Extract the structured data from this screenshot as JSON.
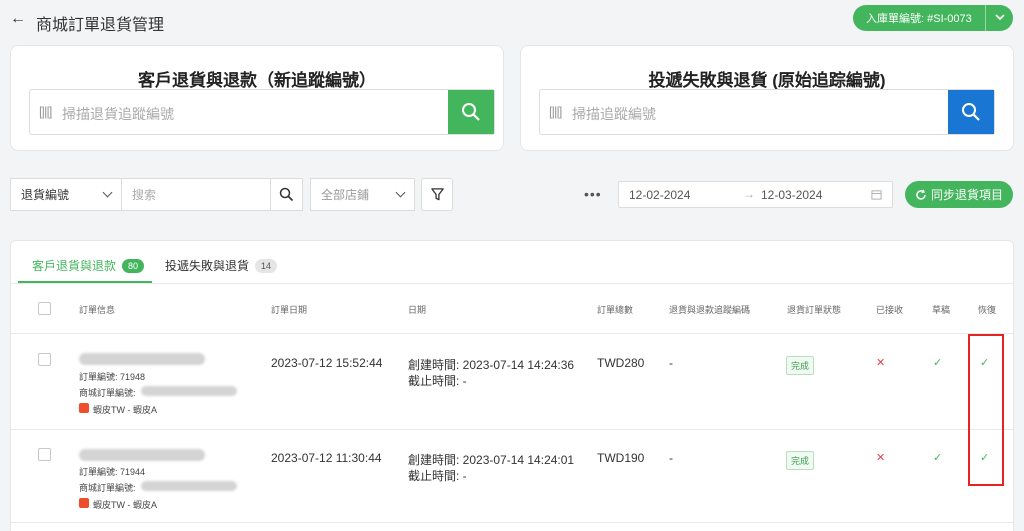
{
  "header": {
    "title": "商城訂單退貨管理",
    "inbound_label": "入庫單編號: #SI-0073"
  },
  "cards": [
    {
      "title": "客戶退貨與退款（新追蹤編號）",
      "placeholder": "掃描退貨追蹤編號"
    },
    {
      "title": "投遞失敗與退貨 (原始追踪編號)",
      "placeholder": "掃描追蹤編號"
    }
  ],
  "filters": {
    "field_select": "退貨編號",
    "search_placeholder": "搜索",
    "store_select": "全部店鋪",
    "more": "•••",
    "date_start": "12-02-2024",
    "date_arrow": "→",
    "date_end": "12-03-2024",
    "sync_label": "同步退貨項目"
  },
  "tabs": [
    {
      "label": "客戶退貨與退款",
      "count": "80"
    },
    {
      "label": "投遞失敗與退貨",
      "count": "14"
    }
  ],
  "columns": [
    "訂單信息",
    "訂單日期",
    "日期",
    "訂單總數",
    "退貨與退款追蹤編碼",
    "退貨訂單狀態",
    "已接收",
    "草稿",
    "恢復"
  ],
  "rows": [
    {
      "order_no": "訂單編號: 71948",
      "mall_order_label": "商城訂單編號:",
      "shop": "蝦皮TW - 蝦皮A",
      "order_date": "2023-07-12 15:52:44",
      "created": "創建時間: 2023-07-14 14:24:36",
      "deadline": "截止時間: -",
      "total": "TWD280",
      "tracking": "-",
      "status": "完成",
      "received": "✕",
      "draft": "✓",
      "restore": "✓"
    },
    {
      "order_no": "訂單編號: 71944",
      "mall_order_label": "商城訂單編號:",
      "shop": "蝦皮TW - 蝦皮A",
      "order_date": "2023-07-12 11:30:44",
      "created": "創建時間: 2023-07-14 14:24:01",
      "deadline": "截止時間: -",
      "total": "TWD190",
      "tracking": "-",
      "status": "完成",
      "received": "✕",
      "draft": "✓",
      "restore": "✓"
    }
  ],
  "colors": {
    "accent": "#43b65d",
    "blue": "#1976d2",
    "danger": "#e04646",
    "highlight": "#e52323"
  }
}
